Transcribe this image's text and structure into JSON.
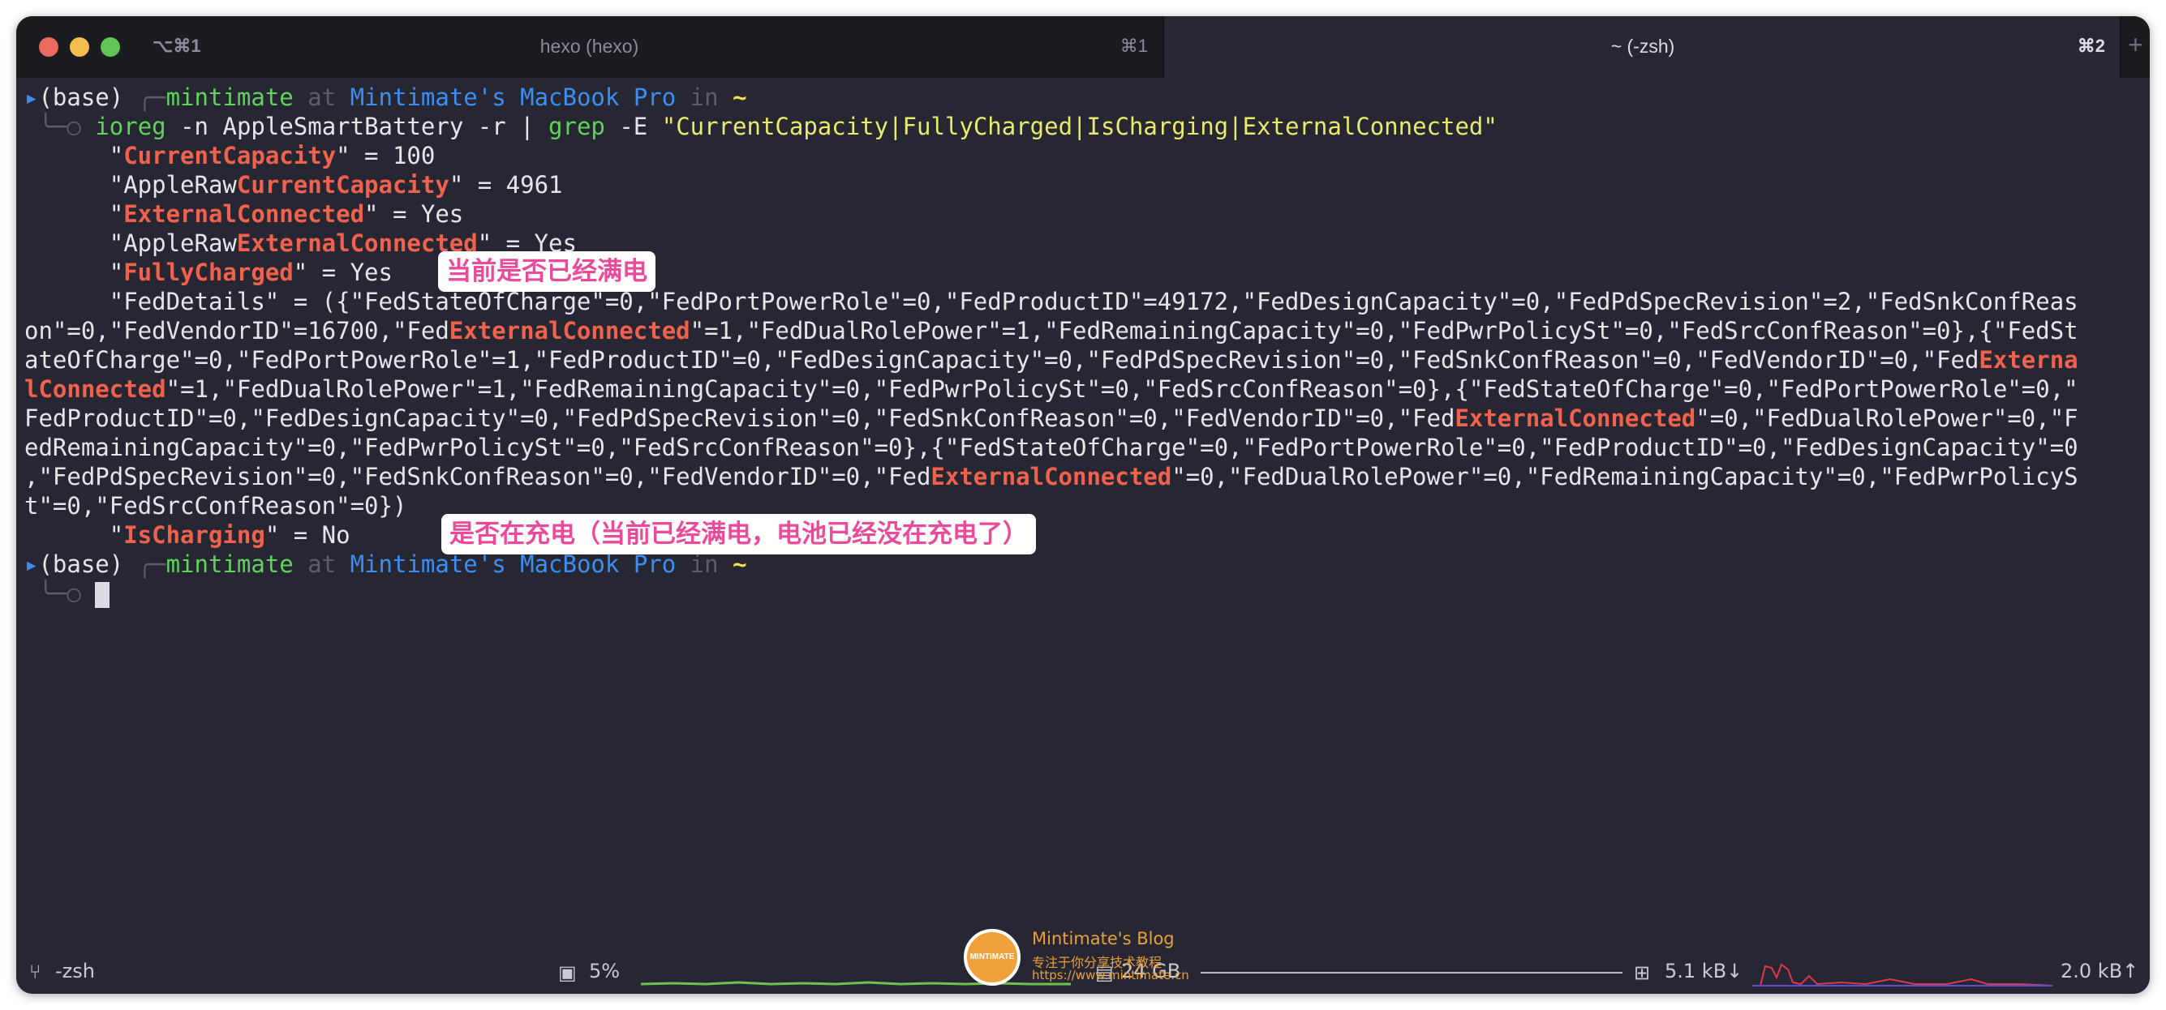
{
  "window": {
    "tab_hotkey": "⌥⌘1",
    "tabs": [
      {
        "title": "hexo (hexo)",
        "shortcut": "⌘1",
        "active": false
      },
      {
        "title": "~ (-zsh)",
        "shortcut": "⌘2",
        "active": true
      }
    ],
    "new_tab_label": "+"
  },
  "terminal": {
    "prompt": {
      "env": "(base)",
      "user": "mintimate",
      "at": "at",
      "host": "Mintimate's MacBook Pro",
      "in": "in",
      "dir": "~"
    },
    "command": {
      "bin": "ioreg",
      "args": " -n AppleSmartBattery -r | ",
      "grep": "grep",
      "grep_flag": " -E ",
      "pattern": "\"CurrentCapacity|FullyCharged|IsCharging|ExternalConnected\""
    },
    "output": {
      "l1a": "      \"",
      "l1b": "CurrentCapacity",
      "l1c": "\" = 100",
      "l2a": "      \"AppleRaw",
      "l2b": "CurrentCapacity",
      "l2c": "\" = 4961",
      "l3a": "      \"",
      "l3b": "ExternalConnected",
      "l3c": "\" = Yes",
      "l4a": "      \"AppleRaw",
      "l4b": "ExternalConnected",
      "l4c": "\" = Yes",
      "l5a": "      \"",
      "l5b": "FullyCharged",
      "l5c": "\" = Yes",
      "fd1": "      \"FedDetails\" = ({\"FedStateOfCharge\"=0,\"FedPortPowerRole\"=0,\"FedProductID\"=49172,\"FedDesignCapacity\"=0,\"FedPdSpecRevision\"=2,\"FedSnkConfReas",
      "fd2a": "on\"=0,\"FedVendorID\"=16700,\"Fed",
      "fd2b": "ExternalConnected",
      "fd2c": "\"=1,\"FedDualRolePower\"=1,\"FedRemainingCapacity\"=0,\"FedPwrPolicySt\"=0,\"FedSrcConfReason\"=0},{\"FedSt",
      "fd3a": "ateOfCharge\"=0,\"FedPortPowerRole\"=1,\"FedProductID\"=0,\"FedDesignCapacity\"=0,\"FedPdSpecRevision\"=0,\"FedSnkConfReason\"=0,\"FedVendorID\"=0,\"Fed",
      "fd3b": "Externa",
      "fd4a": "lConnected",
      "fd4b": "\"=1,\"FedDualRolePower\"=1,\"FedRemainingCapacity\"=0,\"FedPwrPolicySt\"=0,\"FedSrcConfReason\"=0},{\"FedStateOfCharge\"=0,\"FedPortPowerRole\"=0,\"",
      "fd5a": "FedProductID\"=0,\"FedDesignCapacity\"=0,\"FedPdSpecRevision\"=0,\"FedSnkConfReason\"=0,\"FedVendorID\"=0,\"Fed",
      "fd5b": "ExternalConnected",
      "fd5c": "\"=0,\"FedDualRolePower\"=0,\"F",
      "fd6": "edRemainingCapacity\"=0,\"FedPwrPolicySt\"=0,\"FedSrcConfReason\"=0},{\"FedStateOfCharge\"=0,\"FedPortPowerRole\"=0,\"FedProductID\"=0,\"FedDesignCapacity\"=0",
      "fd7a": ",\"FedPdSpecRevision\"=0,\"FedSnkConfReason\"=0,\"FedVendorID\"=0,\"Fed",
      "fd7b": "ExternalConnected",
      "fd7c": "\"=0,\"FedDualRolePower\"=0,\"FedRemainingCapacity\"=0,\"FedPwrPolicyS",
      "fd8": "t\"=0,\"FedSrcConfReason\"=0})",
      "l6a": "      \"",
      "l6b": "IsCharging",
      "l6c": "\" = No"
    },
    "annotations": {
      "fully_charged": "当前是否已经满电",
      "is_charging": "是否在充电（当前已经满电，电池已经没在充电了）"
    }
  },
  "statusbar": {
    "shell": "-zsh",
    "cpu": "5%",
    "memory": "24 GB",
    "net_down": "5.1 kB↓",
    "net_up": "2.0 kB↑"
  },
  "watermark": {
    "title": "Mintimate's Blog",
    "subtitle": "专注于你分享技术教程",
    "url": "https://www.mintimate.cn",
    "logo_text": "MINTIMATE"
  },
  "colors": {
    "background": "#262733",
    "highlight": "#f0624d",
    "annotation_text": "#ea4a9a",
    "prompt_user": "#5fd35a",
    "prompt_host": "#3d8ef2"
  }
}
